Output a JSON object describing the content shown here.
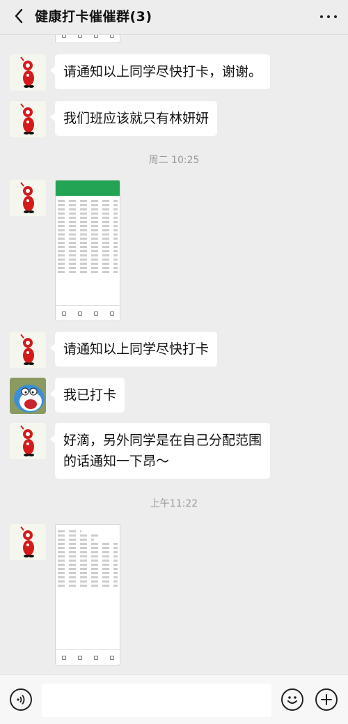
{
  "header": {
    "title": "健康打卡催催群(3)",
    "back_icon": "chevron-left-icon",
    "more_icon": "more-dots-icon"
  },
  "messages": [
    {
      "type": "text",
      "avatar": "red-character",
      "text": "请通知以上同学尽快打卡，谢谢。"
    },
    {
      "type": "text",
      "avatar": "red-character",
      "text": "我们班应该就只有林妍妍"
    },
    {
      "type": "time",
      "text": "周二 10:25"
    },
    {
      "type": "image",
      "avatar": "red-character"
    },
    {
      "type": "text",
      "avatar": "red-character",
      "text": "请通知以上同学尽快打卡"
    },
    {
      "type": "text",
      "avatar": "doraemon",
      "text": "我已打卡"
    },
    {
      "type": "text",
      "avatar": "red-character",
      "lines": [
        "好滴，另外同学是在自己分配范围",
        "的话通知一下昂～"
      ]
    },
    {
      "type": "time",
      "text": "上午11:22"
    },
    {
      "type": "image",
      "avatar": "red-character"
    }
  ],
  "input_bar": {
    "voice_icon": "voice-icon",
    "emoji_icon": "emoji-icon",
    "plus_icon": "plus-icon"
  },
  "colors": {
    "background": "#ededed",
    "bubble": "#ffffff",
    "avatar_red": "#d51a1c",
    "screenshot_header": "#23a455"
  }
}
